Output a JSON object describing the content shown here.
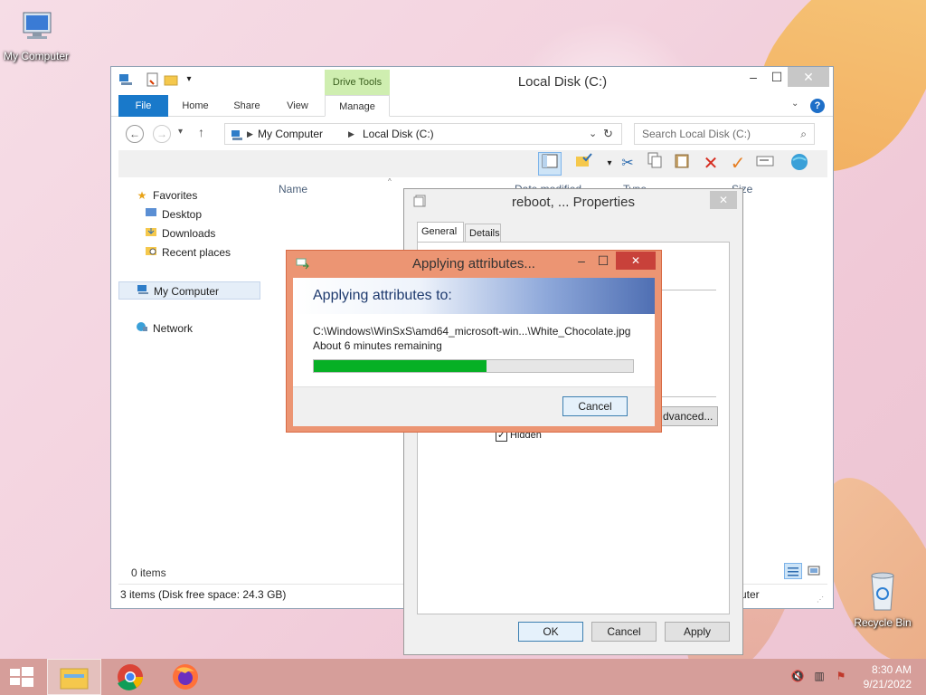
{
  "desktop": {
    "icons": [
      {
        "label": "My Computer",
        "icon": "computer-icon"
      },
      {
        "label": "Recycle Bin",
        "icon": "recycle-bin-icon"
      }
    ]
  },
  "explorer": {
    "title": "Local Disk (C:)",
    "context_tab": "Drive Tools",
    "tabs": [
      "File",
      "Home",
      "Share",
      "View",
      "Manage"
    ],
    "breadcrumb": [
      "My Computer",
      "Local Disk (C:)"
    ],
    "search_placeholder": "Search Local Disk (C:)",
    "nav": {
      "favorites": "Favorites",
      "desktop": "Desktop",
      "downloads": "Downloads",
      "recent": "Recent places",
      "computer": "My Computer",
      "network": "Network"
    },
    "columns": {
      "name": "Name",
      "date": "Date modified",
      "type": "Type",
      "size": "Size"
    },
    "items_count": "0 items",
    "status": "3 items (Disk free space: 24.3 GB)",
    "status_right": "uter"
  },
  "properties": {
    "title": "reboot, ... Properties",
    "tabs": [
      "General",
      "Details"
    ],
    "advanced_label": "dvanced...",
    "hidden_label": "Hidden",
    "hidden_checked": true,
    "buttons": {
      "ok": "OK",
      "cancel": "Cancel",
      "apply": "Apply"
    }
  },
  "applying": {
    "title": "Applying attributes...",
    "heading": "Applying attributes to:",
    "path": "C:\\Windows\\WinSxS\\amd64_microsoft-win...\\White_Chocolate.jpg",
    "remaining": "About 6 minutes remaining",
    "progress_fraction": 0.54,
    "cancel": "Cancel"
  },
  "taskbar": {
    "time": "8:30 AM",
    "date": "9/21/2022"
  },
  "colors": {
    "accent": "#1979ca",
    "progress": "#06b025",
    "dialog_frame": "#ec9573",
    "taskbar": "#d69e9a"
  }
}
